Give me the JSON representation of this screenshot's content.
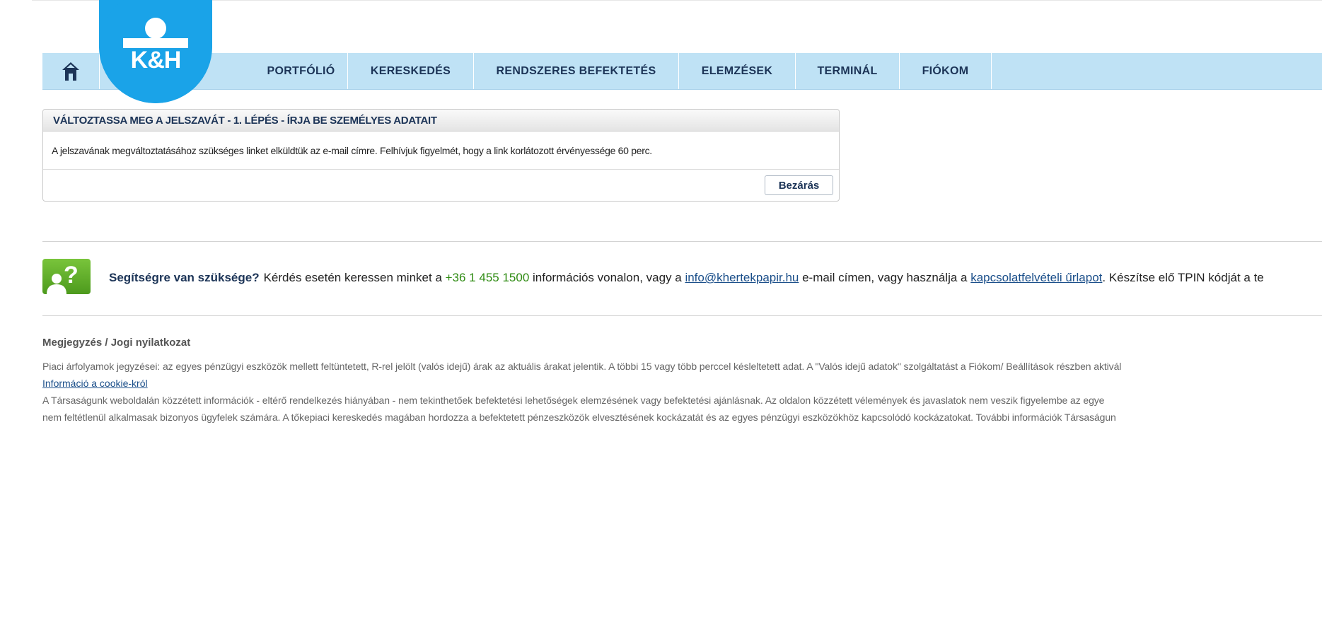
{
  "nav": {
    "logo_text": "K&H",
    "items": [
      {
        "label": "PORTFÓLIÓ"
      },
      {
        "label": "KERESKEDÉS"
      },
      {
        "label": "RENDSZERES BEFEKTETÉS"
      },
      {
        "label": "ELEMZÉSEK"
      },
      {
        "label": "TERMINÁL"
      },
      {
        "label": "FIÓKOM"
      }
    ]
  },
  "dialog": {
    "title": "VÁLTOZTASSA MEG A JELSZAVÁT - 1. LÉPÉS - ÍRJA BE SZEMÉLYES ADATAIT",
    "message": "A jelszavának megváltoztatásához szükséges linket elküldtük az e-mail címre. Felhívjuk figyelmét, hogy a link korlátozott érvényessége 60 perc.",
    "close_label": "Bezárás"
  },
  "help": {
    "question": "Segítségre van szüksége?",
    "text1": "Kérdés esetén keressen minket a ",
    "phone": "+36 1 455 1500",
    "text2": " információs vonalon, vagy a ",
    "email": "info@khertekpapir.hu",
    "text3": " e-mail címen, vagy használja a ",
    "form_link": "kapcsolatfelvételi űrlapot",
    "text4": ". Készítse elő TPIN kódját a te"
  },
  "disclaimer": {
    "title": "Megjegyzés / Jogi nyilatkozat",
    "line1": "Piaci árfolyamok jegyzései: az egyes pénzügyi eszközök mellett feltüntetett, R-rel jelölt (valós idejű) árak az aktuális árakat jelentik. A többi 15 vagy több perccel késleltetett adat. A \"Valós idejű adatok\" szolgáltatást a Fiókom/ Beállítások részben aktivál",
    "cookie_link": "Információ a cookie-król",
    "line2": "A Társaságunk weboldalán közzétett információk - eltérő rendelkezés hiányában - nem tekinthetőek befektetési lehetőségek elemzésének vagy befektetési ajánlásnak. Az oldalon közzétett vélemények és javaslatok nem veszik figyelembe az egye",
    "line3": "nem feltétlenül alkalmasak bizonyos ügyfelek számára. A tőkepiaci kereskedés magában hordozza a befektetett pénzeszközök elvesztésének kockázatát és az egyes pénzügyi eszközökhöz kapcsolódó kockázatokat. További információk Társaságun"
  },
  "colors": {
    "nav_bg": "#bfe2f5",
    "nav_text": "#1c3457",
    "logo_blue": "#1aa3e8",
    "help_green": "#4d9a1d",
    "phone_green": "#2e8b12",
    "link_blue": "#1b4f8a"
  },
  "icons": {
    "home": "home-icon",
    "help": "help-person-icon"
  }
}
